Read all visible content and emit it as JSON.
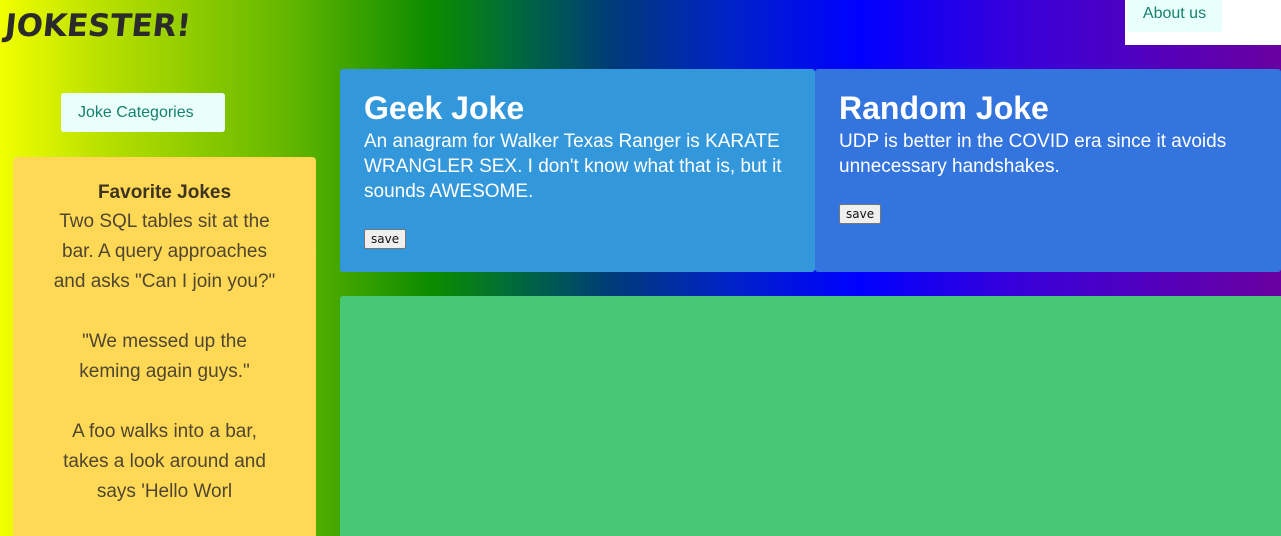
{
  "header": {
    "logo_text": "JOKESTER!",
    "about_label": "About us"
  },
  "sidebar": {
    "categories_label": "Joke Categories",
    "favorites": {
      "title": "Favorite Jokes",
      "items": [
        "Two SQL tables sit at the bar. A query approaches and asks \"Can I join you?\"",
        "\"We messed up the keming again guys.\"",
        "A foo walks into a bar, takes a look around and says 'Hello Worl"
      ]
    }
  },
  "cards": {
    "geek": {
      "title": "Geek Joke",
      "text": "An anagram for Walker Texas Ranger is KARATE WRANGLER SEX. I don't know what that is, but it sounds AWESOME.",
      "save_label": "save"
    },
    "random": {
      "title": "Random Joke",
      "text": "UDP is better in the COVID era since it avoids unnecessary handshakes.",
      "save_label": "save"
    }
  },
  "colors": {
    "geek_card": "#3397db",
    "random_card": "#3374df",
    "favorites_panel": "#ffd956",
    "content_panel": "#48c874",
    "button_text": "#17806f"
  }
}
